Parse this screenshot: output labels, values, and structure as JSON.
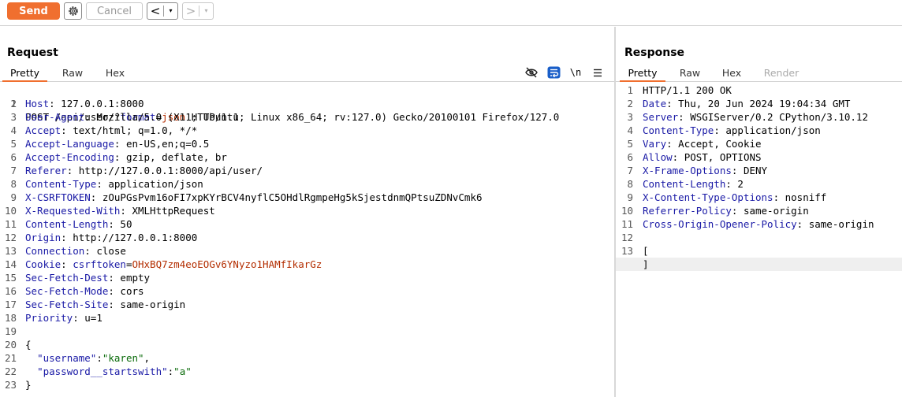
{
  "toolbar": {
    "send_label": "Send",
    "settings_icon": "gear-icon",
    "cancel_label": "Cancel",
    "back_glyph": "<",
    "forward_glyph": ">",
    "dropdown_glyph": "▾",
    "accent_color": "#f06f2f"
  },
  "request": {
    "title": "Request",
    "tabs": [
      "Pretty",
      "Raw",
      "Hex"
    ],
    "active_tab": "Pretty",
    "tools": {
      "hide_icon": "eye-slash-icon",
      "wrap_icon": "word-wrap-icon",
      "newline_label": "\\n",
      "menu_icon": "hamburger-menu-icon"
    },
    "line_numbers": [
      "1",
      "2",
      "3",
      "4",
      "5",
      "6",
      "7",
      "8",
      "9",
      "10",
      "11",
      "12",
      "13",
      "14",
      "15",
      "16",
      "17",
      "18",
      "19",
      "20",
      "21",
      "22",
      "23"
    ],
    "request_line": {
      "method_path": "POST /api/user/?",
      "query_name": "format",
      "equals": "=",
      "query_value": "json",
      "protocol": " HTTP/1.1"
    },
    "headers": [
      {
        "name": "Host",
        "value": " 127.0.0.1:8000"
      },
      {
        "name": "User-Agent",
        "value": " Mozilla/5.0 (X11; Ubuntu; Linux x86_64; rv:127.0) Gecko/20100101 Firefox/127.0"
      },
      {
        "name": "Accept",
        "value": " text/html; q=1.0, */*"
      },
      {
        "name": "Accept-Language",
        "value": " en-US,en;q=0.5"
      },
      {
        "name": "Accept-Encoding",
        "value": " gzip, deflate, br"
      },
      {
        "name": "Referer",
        "value": " http://127.0.0.1:8000/api/user/"
      },
      {
        "name": "Content-Type",
        "value": " application/json"
      },
      {
        "name": "X-CSRFTOKEN",
        "value": " zOuPGsPvm16oFI7xpKYrBCV4nyflC5OHdlRgmpeHg5kSjestdnmQPtsuZDNvCmk6"
      },
      {
        "name": "X-Requested-With",
        "value": " XMLHttpRequest"
      },
      {
        "name": "Content-Length",
        "value": " 50"
      },
      {
        "name": "Origin",
        "value": " http://127.0.0.1:8000"
      },
      {
        "name": "Connection",
        "value": " close"
      }
    ],
    "cookie": {
      "name": "Cookie",
      "sep": ": ",
      "key": "csrftoken",
      "eq": "=",
      "value": "OHxBQ7zm4eoEOGv6YNyzo1HAMfIkarGz"
    },
    "headers_after": [
      {
        "name": "Sec-Fetch-Dest",
        "value": " empty"
      },
      {
        "name": "Sec-Fetch-Mode",
        "value": " cors"
      },
      {
        "name": "Sec-Fetch-Site",
        "value": " same-origin"
      },
      {
        "name": "Priority",
        "value": " u=1"
      }
    ],
    "body": {
      "open": "{",
      "entries": [
        {
          "indent": "  ",
          "key": "\"username\"",
          "colon": ":",
          "value": "\"karen\"",
          "trail": ","
        },
        {
          "indent": "  ",
          "key": "\"password__startswith\"",
          "colon": ":",
          "value": "\"a\"",
          "trail": ""
        }
      ],
      "close": "}"
    }
  },
  "response": {
    "title": "Response",
    "tabs": [
      "Pretty",
      "Raw",
      "Hex",
      "Render"
    ],
    "active_tab": "Pretty",
    "line_numbers": [
      "1",
      "2",
      "3",
      "4",
      "5",
      "6",
      "7",
      "8",
      "9",
      "10",
      "11",
      "12",
      "13"
    ],
    "status_line": "HTTP/1.1 200 OK",
    "headers": [
      {
        "name": "Date",
        "value": " Thu, 20 Jun 2024 19:04:34 GMT"
      },
      {
        "name": "Server",
        "value": " WSGIServer/0.2 CPython/3.10.12"
      },
      {
        "name": "Content-Type",
        "value": " application/json"
      },
      {
        "name": "Vary",
        "value": " Accept, Cookie"
      },
      {
        "name": "Allow",
        "value": " POST, OPTIONS"
      },
      {
        "name": "X-Frame-Options",
        "value": " DENY"
      },
      {
        "name": "Content-Length",
        "value": " 2"
      },
      {
        "name": "X-Content-Type-Options",
        "value": " nosniff"
      },
      {
        "name": "Referrer-Policy",
        "value": " same-origin"
      },
      {
        "name": "Cross-Origin-Opener-Policy",
        "value": " same-origin"
      }
    ],
    "body_open": "[",
    "body_close": "]"
  }
}
